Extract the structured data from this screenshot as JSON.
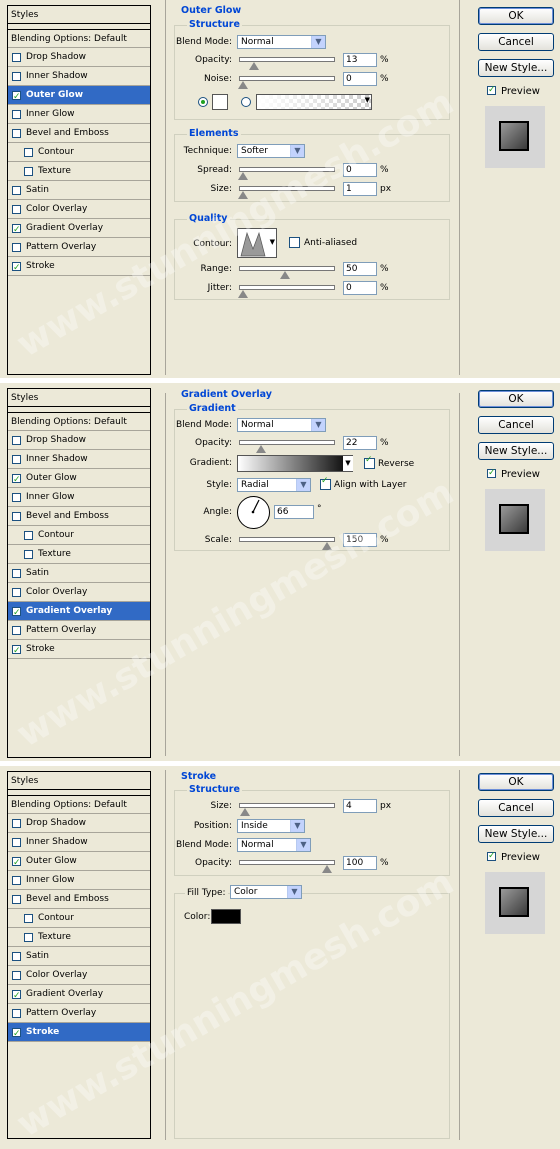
{
  "watermark": "www.stunningmesh.com",
  "buttons": {
    "ok": "OK",
    "cancel": "Cancel",
    "new_style": "New Style...",
    "preview": "Preview"
  },
  "sidebar": {
    "title": "Styles",
    "blending": "Blending Options: Default",
    "items": [
      "Drop Shadow",
      "Inner Shadow",
      "Outer Glow",
      "Inner Glow",
      "Bevel and Emboss",
      "Contour",
      "Texture",
      "Satin",
      "Color Overlay",
      "Gradient Overlay",
      "Pattern Overlay",
      "Stroke"
    ]
  },
  "panel1": {
    "section": "Outer Glow",
    "structure": "Structure",
    "blend_label": "Blend Mode:",
    "blend_value": "Normal",
    "opacity_label": "Opacity:",
    "opacity_value": "13",
    "opacity_level": 13,
    "noise_label": "Noise:",
    "noise_value": "0",
    "noise_level": 0,
    "elements": "Elements",
    "technique_label": "Technique:",
    "technique_value": "Softer",
    "spread_label": "Spread:",
    "spread_value": "0",
    "spread_level": 0,
    "size_label": "Size:",
    "size_value": "1",
    "size_unit": "px",
    "size_level": 0,
    "quality": "Quality",
    "contour_label": "Contour:",
    "anti_aliased": "Anti-aliased",
    "range_label": "Range:",
    "range_value": "50",
    "range_level": 50,
    "jitter_label": "Jitter:",
    "jitter_value": "0",
    "jitter_level": 0,
    "checked": [
      false,
      false,
      true,
      false,
      false,
      false,
      false,
      false,
      false,
      true,
      false,
      true
    ]
  },
  "panel2": {
    "section": "Gradient Overlay",
    "gradient": "Gradient",
    "blend_label": "Blend Mode:",
    "blend_value": "Normal",
    "opacity_label": "Opacity:",
    "opacity_value": "22",
    "opacity_level": 22,
    "gradient_label": "Gradient:",
    "reverse": "Reverse",
    "style_label": "Style:",
    "style_value": "Radial",
    "align": "Align with Layer",
    "angle_label": "Angle:",
    "angle_value": "66",
    "angle_unit": "°",
    "scale_label": "Scale:",
    "scale_value": "150",
    "scale_level": 100,
    "checked": [
      false,
      false,
      true,
      false,
      false,
      false,
      false,
      false,
      false,
      true,
      false,
      true
    ]
  },
  "panel3": {
    "section": "Stroke",
    "structure": "Structure",
    "size_label": "Size:",
    "size_value": "4",
    "size_unit": "px",
    "size_level": 2,
    "position_label": "Position:",
    "position_value": "Inside",
    "blend_label": "Blend Mode:",
    "blend_value": "Normal",
    "opacity_label": "Opacity:",
    "opacity_value": "100",
    "opacity_level": 100,
    "fill_type_label": "Fill Type:",
    "fill_type_value": "Color",
    "color_label": "Color:",
    "color": "#000000",
    "checked": [
      false,
      false,
      true,
      false,
      false,
      false,
      false,
      false,
      false,
      true,
      false,
      true
    ]
  },
  "pct": "%"
}
